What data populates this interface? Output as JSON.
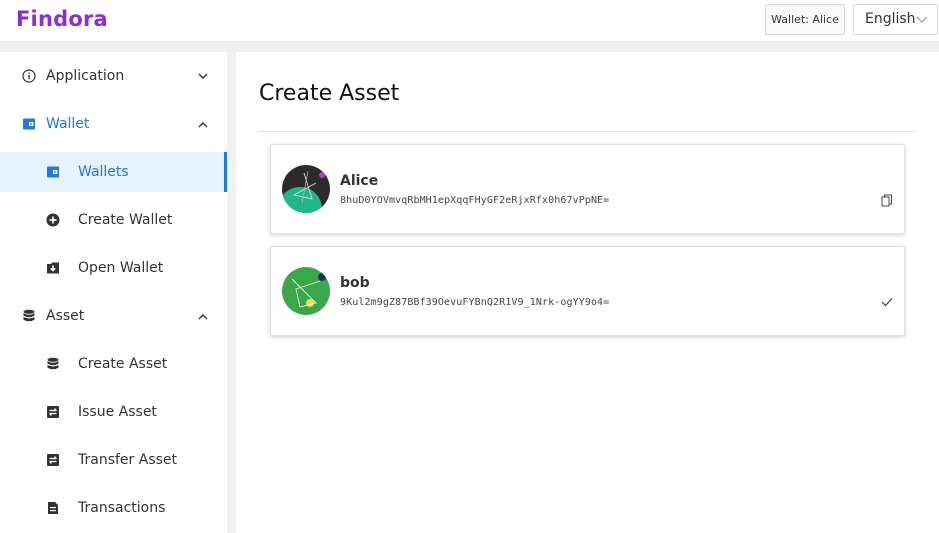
{
  "header": {
    "logo": "Findora",
    "wallet_button": "Wallet: Alice",
    "language": "English"
  },
  "sidebar": {
    "items": [
      {
        "label": "Application",
        "icon": "info-icon",
        "level": "top",
        "arrow": "chevron-down-icon"
      },
      {
        "label": "Wallet",
        "icon": "wallet-icon",
        "level": "top",
        "arrow": "chevron-up-icon",
        "expanded": true
      },
      {
        "label": "Wallets",
        "icon": "wallet-icon",
        "level": "sub",
        "active": true
      },
      {
        "label": "Create Wallet",
        "icon": "plus-circle-icon",
        "level": "sub"
      },
      {
        "label": "Open Wallet",
        "icon": "download-icon",
        "level": "sub"
      },
      {
        "label": "Asset",
        "icon": "database-icon",
        "level": "top",
        "arrow": "chevron-up-icon",
        "expanded": true
      },
      {
        "label": "Create Asset",
        "icon": "database-icon",
        "level": "sub"
      },
      {
        "label": "Issue Asset",
        "icon": "swap-icon",
        "level": "sub"
      },
      {
        "label": "Transfer Asset",
        "icon": "swap-icon",
        "level": "sub"
      },
      {
        "label": "Transactions",
        "icon": "document-icon",
        "level": "sub"
      }
    ]
  },
  "main": {
    "title": "Create Asset",
    "wallets": [
      {
        "name": "Alice",
        "address": "8huD0YOVmvqRbMH1epXqqFHyGF2eRjxRfx0h67vPpNE=",
        "action_icon": "copy-icon"
      },
      {
        "name": "bob",
        "address": "9Kul2m9gZ87BBf39OevuFYBnQ2R1V9_1Nrk-ogYY9o4=",
        "action_icon": "check-icon"
      }
    ]
  },
  "colors": {
    "brand": "#8b2fd1",
    "accent": "#1f7ad8",
    "active_bg": "#e6f3fc"
  }
}
